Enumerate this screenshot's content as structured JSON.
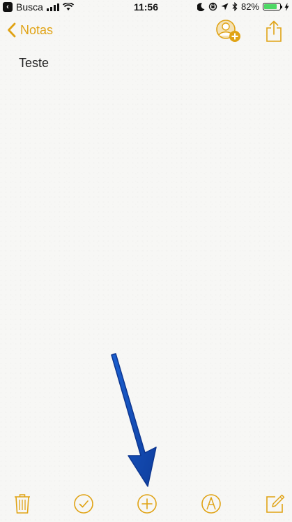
{
  "status_bar": {
    "back_app_label": "Busca",
    "time": "11:56",
    "battery": "82%",
    "battery_level": 0.82,
    "icons": [
      "signal-icon",
      "wifi-icon",
      "moon-icon",
      "rotation-lock-icon",
      "location-icon",
      "bluetooth-icon",
      "battery-icon",
      "charging-icon"
    ]
  },
  "nav": {
    "back_label": "Notas",
    "actions": [
      "add-person-icon",
      "share-icon"
    ]
  },
  "note": {
    "text": "Teste"
  },
  "toolbar": {
    "items": [
      "trash-icon",
      "checklist-icon",
      "add-icon",
      "markup-icon",
      "compose-icon"
    ]
  },
  "colors": {
    "accent": "#e0a315",
    "background": "#f7f7f5",
    "annotation_arrow": "#1550c0",
    "battery_fill": "#4cd964"
  }
}
